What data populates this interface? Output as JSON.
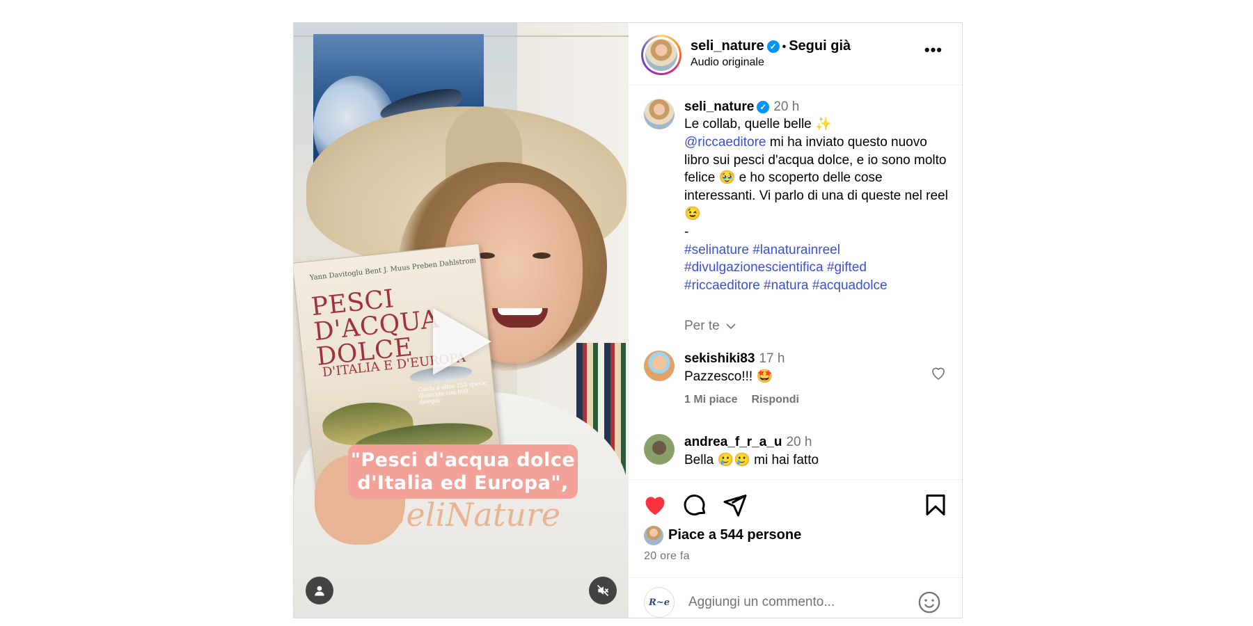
{
  "post": {
    "username": "seli_nature",
    "follow_status": "Segui già",
    "audio_label": "Audio originale",
    "more_label": "•••"
  },
  "media": {
    "overlay_caption_line1": "\"Pesci d'acqua dolce",
    "overlay_caption_line2": "d'Italia ed Europa\",",
    "book_authors": "Yann Davitoglu   Bent J. Muus   Preben Dahlstrom",
    "book_title": "PESCI\nD'ACQUA\nDOLCE",
    "book_subtitle": "D'ITALIA E D'EUROPA",
    "book_guide": "Guida a oltre 150 specie illustrate con 800 disegni",
    "shirt_text": "SeliNature"
  },
  "caption": {
    "username": "seli_nature",
    "time": "20 h",
    "line1": "Le collab, quelle belle ✨",
    "mention": "@riccaeditore",
    "body": " mi ha inviato questo nuovo libro sui pesci d'acqua dolce, e io sono molto felice 🥹 e ho scoperto delle cose interessanti. Vi parlo di una di queste nel reel 😉",
    "dash": "-",
    "hashtags_line1": "#selinature #lanaturainreel",
    "hashtags_line2": "#divulgazionescientifica #gifted",
    "hashtags_line3": "#riccaeditore #natura #acquadolce",
    "per_te": "Per te"
  },
  "comments": [
    {
      "username": "sekishiki83",
      "time": "17 h",
      "text": "Pazzesco!!! 🤩",
      "likes": "1 Mi piace",
      "reply": "Rispondi"
    },
    {
      "username": "andrea_f_r_a_u",
      "time": "20 h",
      "text": "Bella 🥲🥲 mi hai fatto"
    }
  ],
  "actions": {
    "likes_text": "Piace a 544 persone",
    "time_ago": "20 ore fa",
    "comment_placeholder": "Aggiungi un commento...",
    "commenter_avatar_text": "R~e"
  },
  "colors": {
    "like_red": "#ff3040",
    "link_blue": "#3b4fd8",
    "verified_blue": "#0095f6",
    "secondary_text": "#737373"
  },
  "icons": [
    "play-icon",
    "user-icon",
    "mute-icon",
    "verified-icon",
    "more-icon",
    "chevron-down-icon",
    "heart-icon",
    "comment-icon",
    "share-icon",
    "bookmark-icon",
    "emoji-icon"
  ]
}
